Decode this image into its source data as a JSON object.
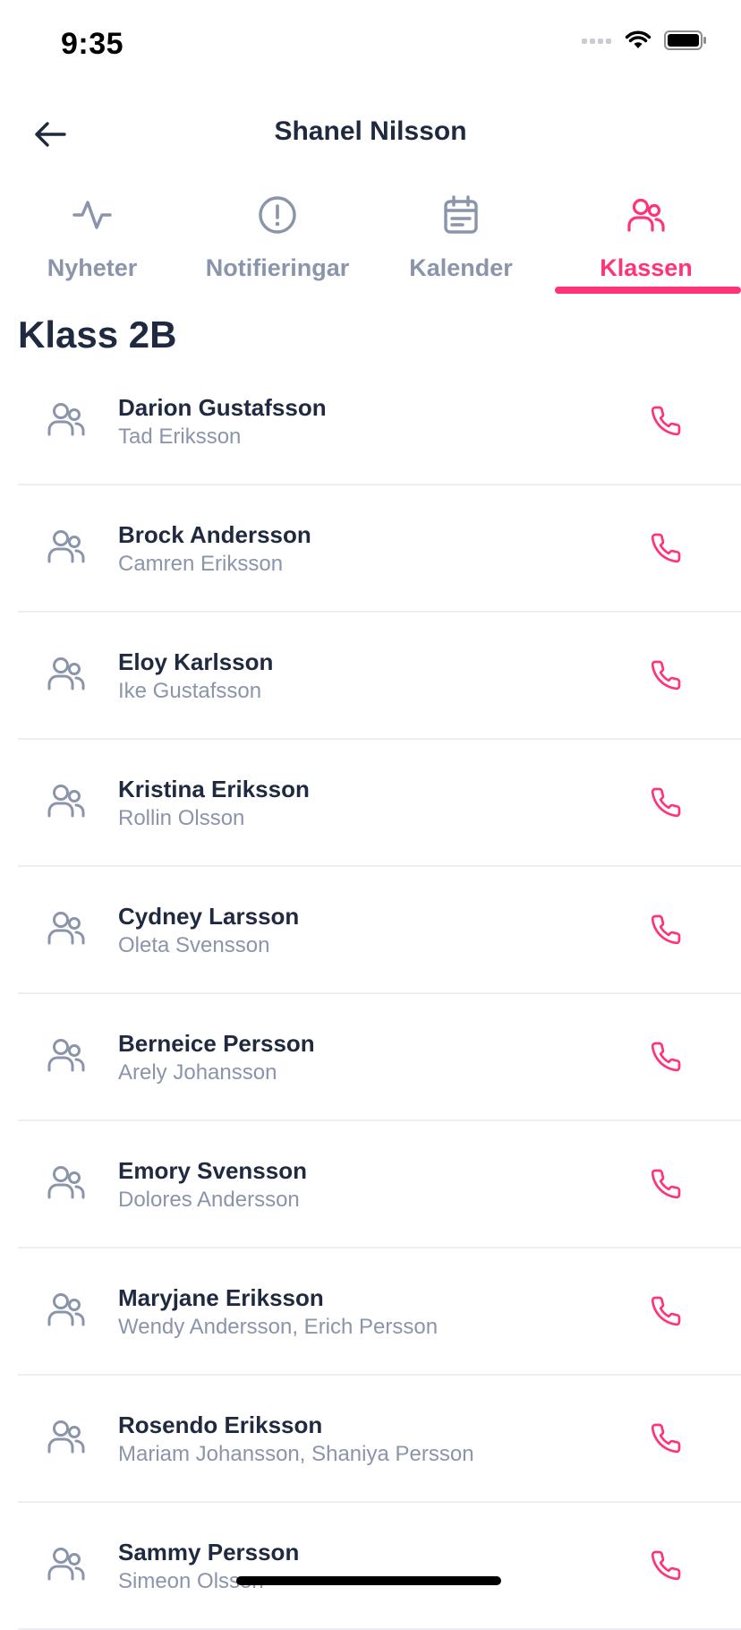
{
  "status_bar": {
    "time": "9:35"
  },
  "header": {
    "title": "Shanel Nilsson",
    "back_icon": "arrow-left-icon"
  },
  "tabs": [
    {
      "label": "Nyheter",
      "icon": "activity-icon",
      "active": false
    },
    {
      "label": "Notifieringar",
      "icon": "alert-circle-icon",
      "active": false
    },
    {
      "label": "Kalender",
      "icon": "calendar-icon",
      "active": false
    },
    {
      "label": "Klassen",
      "icon": "users-icon",
      "active": true
    }
  ],
  "section": {
    "title": "Klass 2B"
  },
  "students": [
    {
      "name": "Darion Gustafsson",
      "guardians": "Tad Eriksson"
    },
    {
      "name": "Brock Andersson",
      "guardians": "Camren Eriksson"
    },
    {
      "name": "Eloy Karlsson",
      "guardians": "Ike Gustafsson"
    },
    {
      "name": "Kristina Eriksson",
      "guardians": "Rollin Olsson"
    },
    {
      "name": "Cydney Larsson",
      "guardians": "Oleta Svensson"
    },
    {
      "name": "Berneice Persson",
      "guardians": "Arely Johansson"
    },
    {
      "name": "Emory Svensson",
      "guardians": "Dolores Andersson"
    },
    {
      "name": "Maryjane Eriksson",
      "guardians": "Wendy Andersson, Erich Persson"
    },
    {
      "name": "Rosendo Eriksson",
      "guardians": "Mariam Johansson, Shaniya Persson"
    },
    {
      "name": "Sammy Persson",
      "guardians": "Simeon Olsson"
    }
  ],
  "colors": {
    "accent": "#ff3478",
    "text_primary": "#1f2940",
    "text_secondary": "#8a94ab",
    "divider": "#eceef3"
  }
}
